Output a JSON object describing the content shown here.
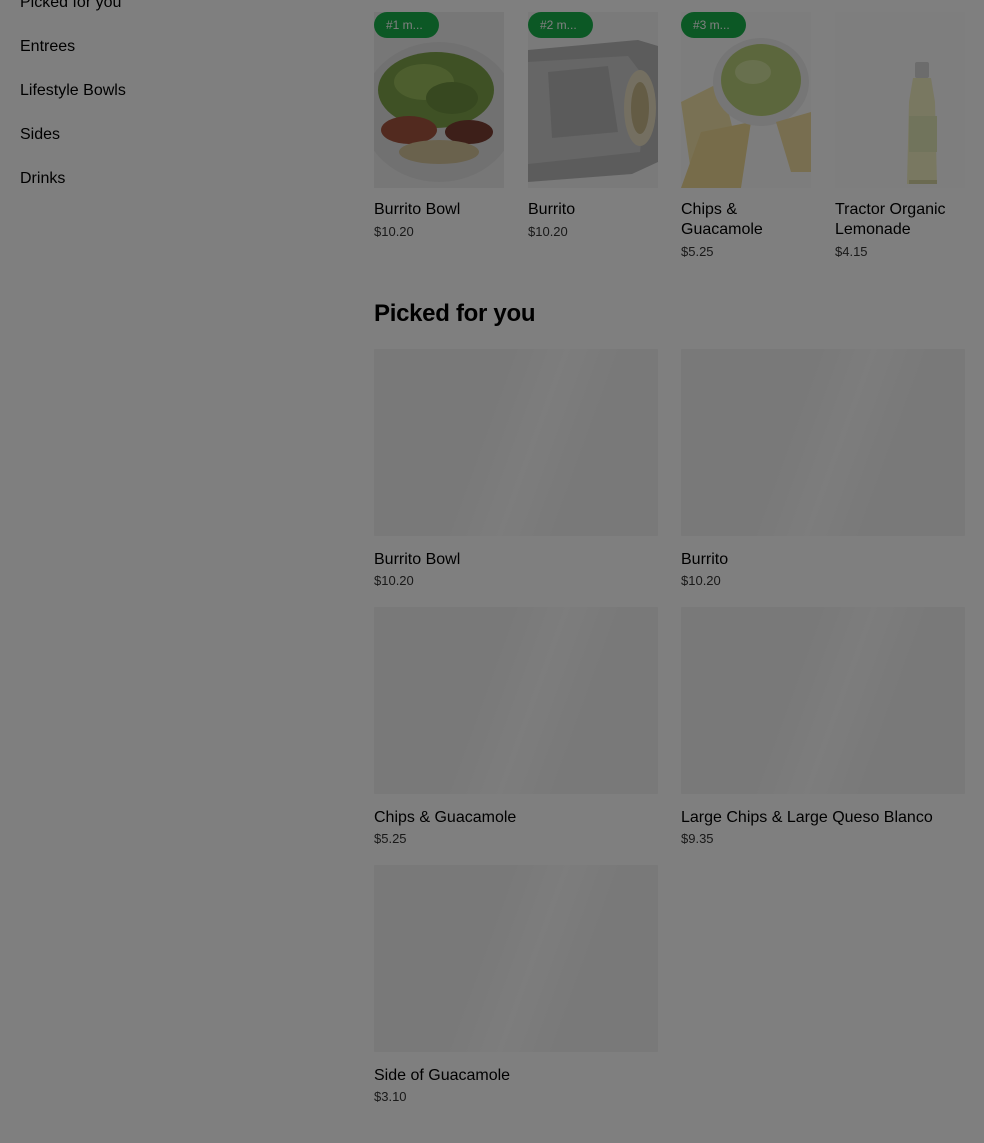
{
  "sidebar": {
    "items": [
      {
        "label": "Picked for you"
      },
      {
        "label": "Entrees"
      },
      {
        "label": "Lifestyle Bowls"
      },
      {
        "label": "Sides"
      },
      {
        "label": "Drinks"
      }
    ]
  },
  "popular": {
    "items": [
      {
        "badge": "#1 m...",
        "name": "Burrito Bowl",
        "price": "$10.20"
      },
      {
        "badge": "#2 m...",
        "name": "Burrito",
        "price": "$10.20"
      },
      {
        "badge": "#3 m...",
        "name": "Chips & Guacamole",
        "price": "$5.25"
      },
      {
        "badge": "",
        "name": "Tractor Organic Lemonade",
        "price": "$4.15"
      }
    ]
  },
  "picked": {
    "title": "Picked for you",
    "items": [
      {
        "name": "Burrito Bowl",
        "price": "$10.20"
      },
      {
        "name": "Burrito",
        "price": "$10.20"
      },
      {
        "name": "Chips & Guacamole",
        "price": "$5.25"
      },
      {
        "name": "Large Chips & Large Queso Blanco",
        "price": "$9.35"
      },
      {
        "name": "Side of Guacamole",
        "price": "$3.10"
      }
    ]
  },
  "colors": {
    "badge": "#18b04b",
    "overlay": "rgba(0,0,0,0.5)"
  }
}
